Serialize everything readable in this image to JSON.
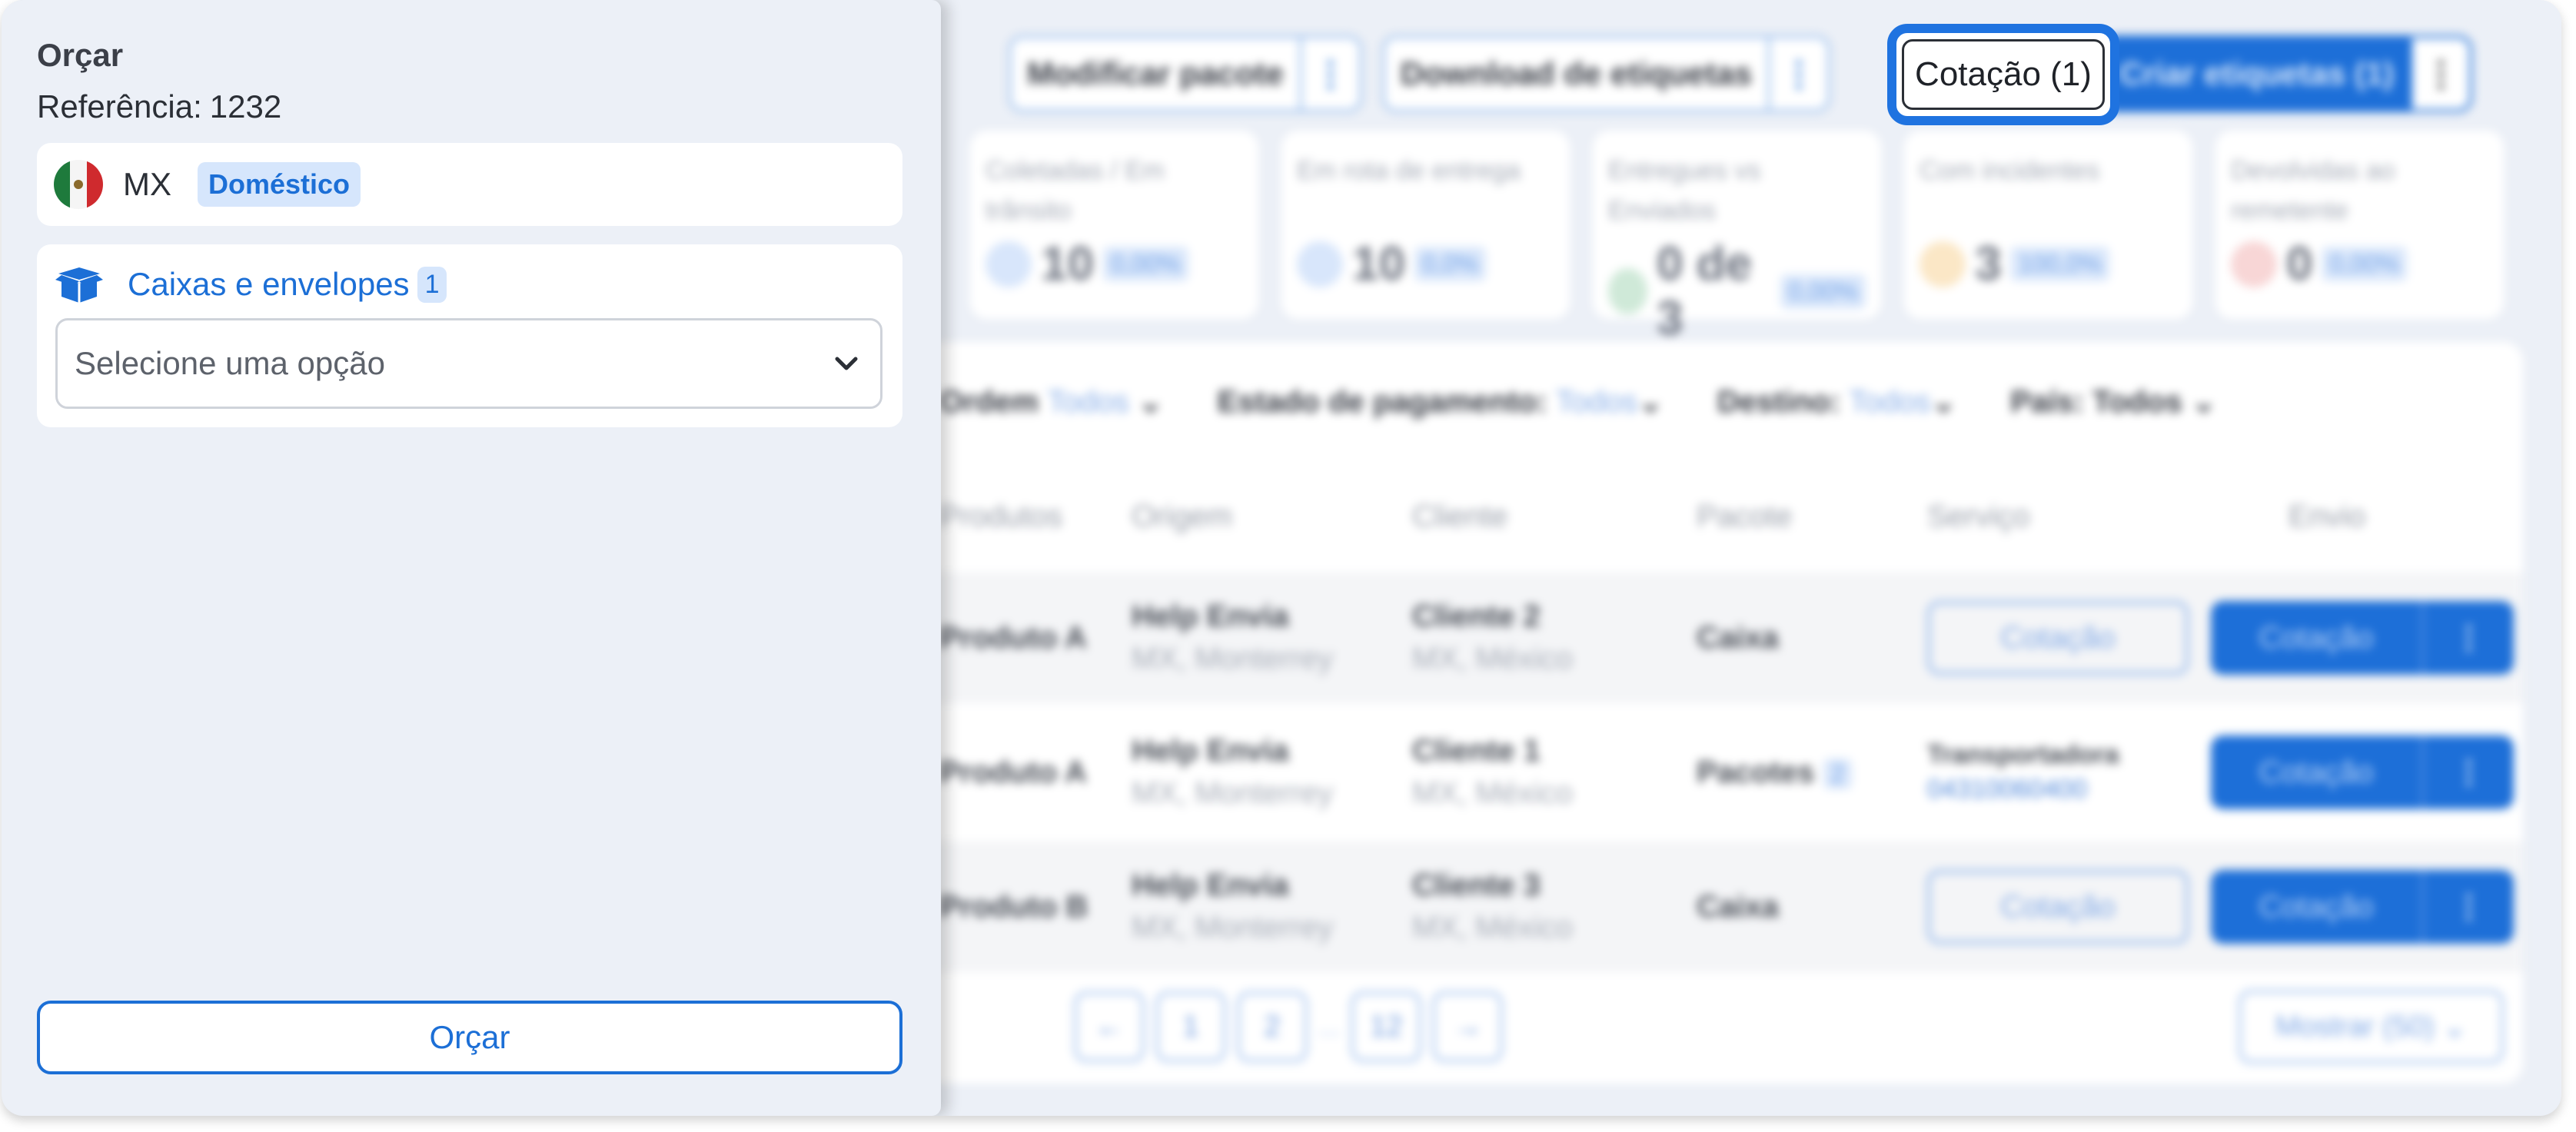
{
  "drawer": {
    "title": "Orçar",
    "reference_label": "Referência:",
    "reference_value": "1232",
    "country_code": "MX",
    "flag_icon": "mexico-flag-icon",
    "country_badge": "Doméstico",
    "packages_label": "Caixas e envelopes",
    "packages_count": "1",
    "package_icon": "box-icon",
    "select_placeholder": "Selecione uma opção",
    "submit_label": "Orçar"
  },
  "toolbar": {
    "modify_label": "Modificar pacote",
    "download_label": "Download de etiquetas",
    "quote_label": "Cotação (1)",
    "create_label": "Criar etiquetas (1)",
    "more_glyph": "⋮",
    "accent_color": "#1d6fd8"
  },
  "stats": [
    {
      "title": "Coletadas / Em trânsito",
      "value": "10",
      "pct": "0,00%"
    },
    {
      "title": "Em rota de entrega",
      "value": "10",
      "pct": "0,0%"
    },
    {
      "title": "Entregues vs Enviados",
      "value": "0 de 3",
      "pct": "0,00%"
    },
    {
      "title": "Com incidentes",
      "value": "3",
      "pct": "100,0%"
    },
    {
      "title": "Devolvidas ao remetente",
      "value": "0",
      "pct": "0,00%"
    }
  ],
  "filters": {
    "order_label": "Ordem",
    "order_value": "Todos",
    "payment_label": "Estado de pagamento:",
    "payment_value": "Todos",
    "destination_label": "Destino:",
    "destination_value": "Todos",
    "country_label": "País: Todos"
  },
  "table": {
    "headers": [
      "Produtos",
      "Origem",
      "Cliente",
      "Pacote",
      "Serviço",
      "Envio"
    ],
    "rows": [
      {
        "product": "Produto A",
        "origin": "Help Envia",
        "origin_sub": "MX, Monterrey",
        "client": "Cliente 2",
        "client_sub": "MX, México",
        "package": "Caixa",
        "service": "Cotação",
        "ship": "Cotação"
      },
      {
        "product": "Produto A",
        "origin": "Help Envia",
        "origin_sub": "MX, Monterrey",
        "client": "Cliente 1",
        "client_sub": "MX, México",
        "package": "Pacotes",
        "package_count": "2",
        "service": "Transportadora",
        "service_sub": "04310060400",
        "ship": "Cotação"
      },
      {
        "product": "Produto B",
        "origin": "Help Envia",
        "origin_sub": "MX, Monterrey",
        "client": "Cliente 3",
        "client_sub": "MX, México",
        "package": "Caixa",
        "service": "Cotação",
        "ship": "Cotação"
      }
    ]
  },
  "pagination": {
    "prev": "←",
    "pages": [
      "1",
      "2",
      "12"
    ],
    "ellipsis": "...",
    "next": "→",
    "show_label": "Mostrar (50)"
  }
}
